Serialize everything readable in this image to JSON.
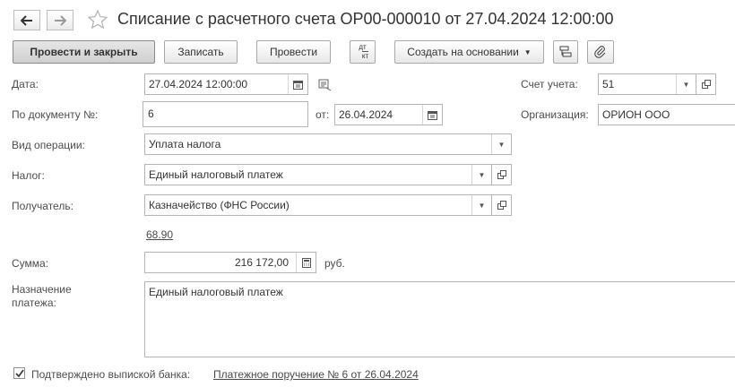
{
  "header": {
    "title": "Списание с расчетного счета ОР00-000010 от 27.04.2024 12:00:00"
  },
  "toolbar": {
    "post_and_close": "Провести и закрыть",
    "save": "Записать",
    "post": "Провести",
    "dt_kt_top": "дт",
    "dt_kt_bottom": "кт",
    "create_based_on": "Создать на основании"
  },
  "form": {
    "date": {
      "label": "Дата:",
      "value": "27.04.2024 12:00:00"
    },
    "doc_number": {
      "label": "По документу №:",
      "value": "6"
    },
    "doc_date": {
      "label": "от:",
      "value": "26.04.2024"
    },
    "operation_type": {
      "label": "Вид операции:",
      "value": "Уплата налога"
    },
    "tax": {
      "label": "Налог:",
      "value": "Единый налоговый платеж"
    },
    "recipient": {
      "label": "Получатель:",
      "value": "Казначейство (ФНС России)"
    },
    "recipient_link": "68.90",
    "amount": {
      "label": "Сумма:",
      "value": "216 172,00",
      "currency": "руб."
    },
    "purpose": {
      "label": "Назначение платежа:",
      "value": "Единый налоговый платеж"
    },
    "account": {
      "label": "Счет учета:",
      "value": "51"
    },
    "organization": {
      "label": "Организация:",
      "value": "ОРИОН ООО"
    }
  },
  "footer": {
    "confirmed_label": "Подтверждено выпиской банка:",
    "confirmed_checked": true,
    "payment_order_link": "Платежное поручение № 6 от 26.04.2024"
  }
}
